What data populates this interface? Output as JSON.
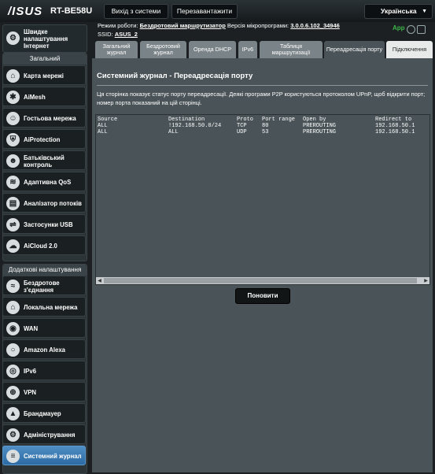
{
  "header": {
    "logo": "/ISUS",
    "model": "RT-BE58U",
    "logout_label": "Вихід з системи",
    "reboot_label": "Перезавантажити",
    "language": "Українська"
  },
  "info": {
    "mode_label": "Режим роботи:",
    "mode_value": "Бездротовий маршрутизатор",
    "firmware_label": "Версія мікропрограми:",
    "firmware_value": "3.0.0.6.102_34946",
    "ssid_label": "SSID:",
    "ssid_value": "ASUS_2",
    "app_label": "App"
  },
  "sidebar": {
    "quick": "Швидке налаштування Інтернет",
    "general_title": "Загальний",
    "general_items": [
      {
        "label": "Карта мережі",
        "icon": "network-map-icon"
      },
      {
        "label": "AiMesh",
        "icon": "aimesh-icon"
      },
      {
        "label": "Гостьова мережа",
        "icon": "guest-network-icon"
      },
      {
        "label": "AiProtection",
        "icon": "aiprotection-icon"
      },
      {
        "label": "Батьківський контроль",
        "icon": "parental-control-icon"
      },
      {
        "label": "Адаптивна QoS",
        "icon": "qos-icon"
      },
      {
        "label": "Аналізатор потоків",
        "icon": "traffic-analyzer-icon"
      },
      {
        "label": "Застосунки USB",
        "icon": "usb-icon"
      },
      {
        "label": "AiCloud 2.0",
        "icon": "aicloud-icon"
      }
    ],
    "advanced_title": "Додаткові налаштування",
    "advanced_items": [
      {
        "label": "Бездротове з'єднання",
        "icon": "wireless-icon"
      },
      {
        "label": "Локальна мережа",
        "icon": "lan-icon"
      },
      {
        "label": "WAN",
        "icon": "wan-icon"
      },
      {
        "label": "Amazon Alexa",
        "icon": "alexa-icon"
      },
      {
        "label": "IPv6",
        "icon": "ipv6-icon"
      },
      {
        "label": "VPN",
        "icon": "vpn-icon"
      },
      {
        "label": "Брандмауер",
        "icon": "firewall-icon"
      },
      {
        "label": "Адміністрування",
        "icon": "administration-icon"
      },
      {
        "label": "Системний журнал",
        "icon": "system-log-icon"
      }
    ]
  },
  "tabs": [
    "Загальний журнал",
    "Бездротовий журнал",
    "Оренда DHCP",
    "IPv6",
    "Таблиця маршрутизації",
    "Переадресація порту",
    "Підключення"
  ],
  "panel": {
    "title": "Системний журнал - Переадресація порту",
    "description": "Ця сторінка показує статус порту переадресації. Деякі програми P2P користуються протоколом UPnP, щоб відкрити порт; номер порта показаний на цій сторінці.",
    "columns": [
      "Source",
      "Destination",
      "Proto",
      "Port range",
      "Open by",
      "Redirect to"
    ],
    "rows": [
      [
        "ALL",
        "!192.168.50.0/24",
        "TCP",
        "80",
        "PREROUTING",
        "192.168.50.1"
      ],
      [
        "ALL",
        "ALL",
        "UDP",
        "53",
        "PREROUTING",
        "192.168.50.1"
      ]
    ],
    "refresh_label": "Поновити"
  }
}
